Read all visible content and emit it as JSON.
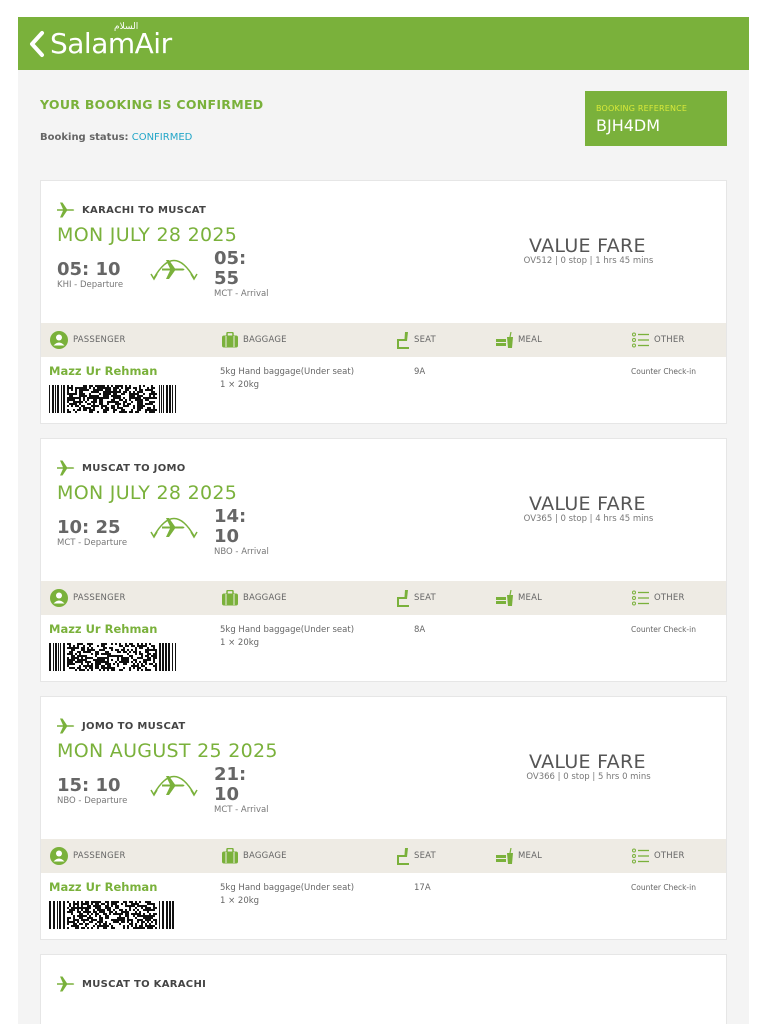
{
  "header": {
    "brand": "SalamAir",
    "brand_arabic": "السلام",
    "brand_color": "#7ab13b"
  },
  "booking": {
    "title": "YOUR BOOKING IS CONFIRMED",
    "status_label": "Booking status:",
    "status_value": "CONFIRMED",
    "reference_label": "BOOKING REFERENCE",
    "reference_value": "BJH4DM"
  },
  "columns": {
    "passenger": "PASSENGER",
    "baggage": "BAGGAGE",
    "seat": "SEAT",
    "meal": "MEAL",
    "other": "OTHER"
  },
  "flights": [
    {
      "route": "KARACHI TO MUSCAT",
      "date": "MON JULY 28 2025",
      "dep_time": "05: 10",
      "dep_label": "KHI - Departure",
      "arr_time": "05: 55",
      "arr_label": "MCT - Arrival",
      "fare": "VALUE FARE",
      "info": "OV512 | 0 stop | 1 hrs 45 mins",
      "passenger": "Mazz Ur Rehman",
      "baggage_line1": "5kg Hand baggage(Under seat)",
      "baggage_line2": "1 × 20kg",
      "seat": "9A",
      "other": "Counter Check-in"
    },
    {
      "route": "MUSCAT TO JOMO",
      "date": "MON JULY 28 2025",
      "dep_time": "10: 25",
      "dep_label": "MCT - Departure",
      "arr_time": "14: 10",
      "arr_label": "NBO - Arrival",
      "fare": "VALUE FARE",
      "info": "OV365 | 0 stop | 4 hrs 45 mins",
      "passenger": "Mazz Ur Rehman",
      "baggage_line1": "5kg Hand baggage(Under seat)",
      "baggage_line2": "1 × 20kg",
      "seat": "8A",
      "other": "Counter Check-in"
    },
    {
      "route": "JOMO TO MUSCAT",
      "date": "MON AUGUST 25 2025",
      "dep_time": "15: 10",
      "dep_label": "NBO - Departure",
      "arr_time": "21: 10",
      "arr_label": "MCT - Arrival",
      "fare": "VALUE FARE",
      "info": "OV366 | 0 stop | 5 hrs 0 mins",
      "passenger": "Mazz Ur Rehman",
      "baggage_line1": "5kg Hand baggage(Under seat)",
      "baggage_line2": "1 × 20kg",
      "seat": "17A",
      "other": "Counter Check-in"
    },
    {
      "route": "MUSCAT TO KARACHI"
    }
  ]
}
